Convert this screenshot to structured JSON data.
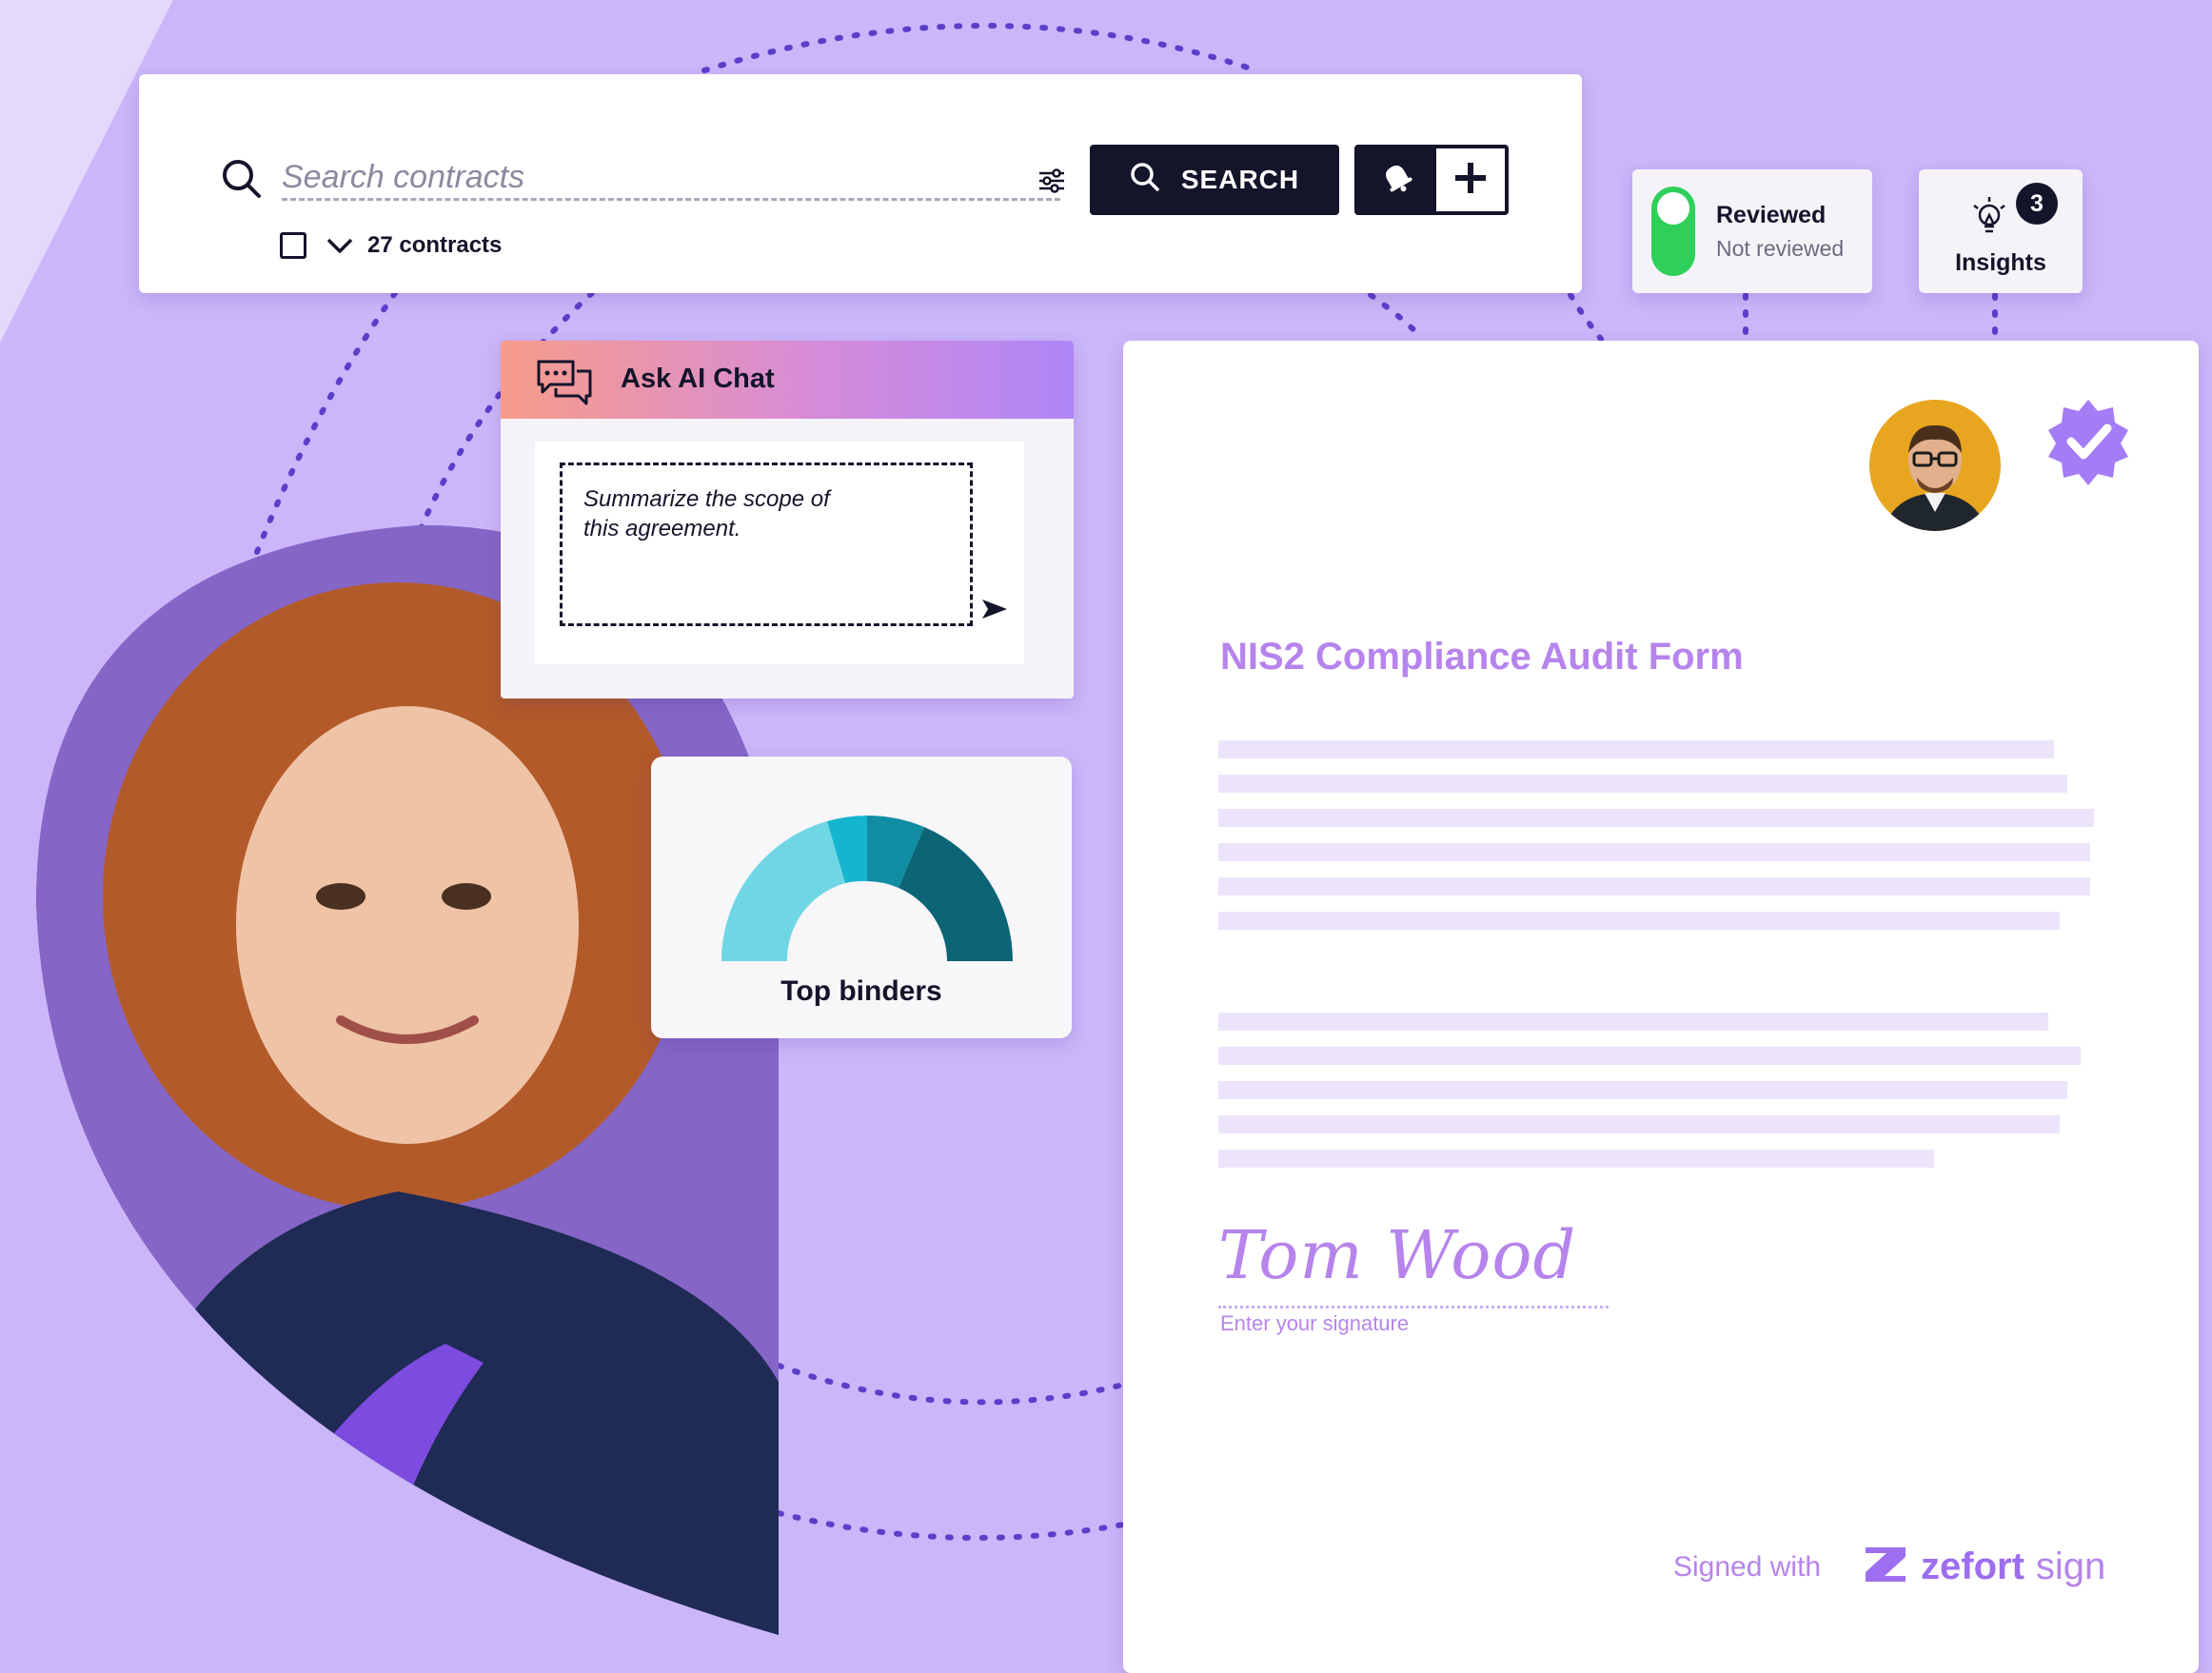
{
  "search": {
    "placeholder": "Search contracts",
    "button_label": "SEARCH",
    "count_label": "27 contracts"
  },
  "review_filter": {
    "option_on": "Reviewed",
    "option_off": "Not reviewed",
    "toggle_color": "#2fd05a"
  },
  "insights": {
    "label": "Insights",
    "badge_count": "3"
  },
  "ai_chat": {
    "title": "Ask AI Chat",
    "prompt": "Summarize the scope of this agreement."
  },
  "binders_widget": {
    "title": "Top binders"
  },
  "document": {
    "title": "NIS2 Compliance Audit Form",
    "signature": "Tom Wood",
    "signature_hint": "Enter your signature",
    "footer_text": "Signed with",
    "brand_name": "zefort",
    "brand_suffix": "sign"
  },
  "icons": [
    "search-icon",
    "filter-sliders-icon",
    "bell-icon",
    "plus-icon",
    "checkbox-icon",
    "chevron-down-icon",
    "lightbulb-icon",
    "chat-bubbles-icon",
    "send-icon",
    "verified-badge-icon",
    "avatar",
    "zefort-logo-icon"
  ],
  "colors": {
    "background": "#cbb6fa",
    "accent_purple": "#b684ec",
    "dark": "#14142b",
    "gauge": [
      "#6fd6e4",
      "#16b5cf",
      "#118da3",
      "#0c6575"
    ]
  }
}
